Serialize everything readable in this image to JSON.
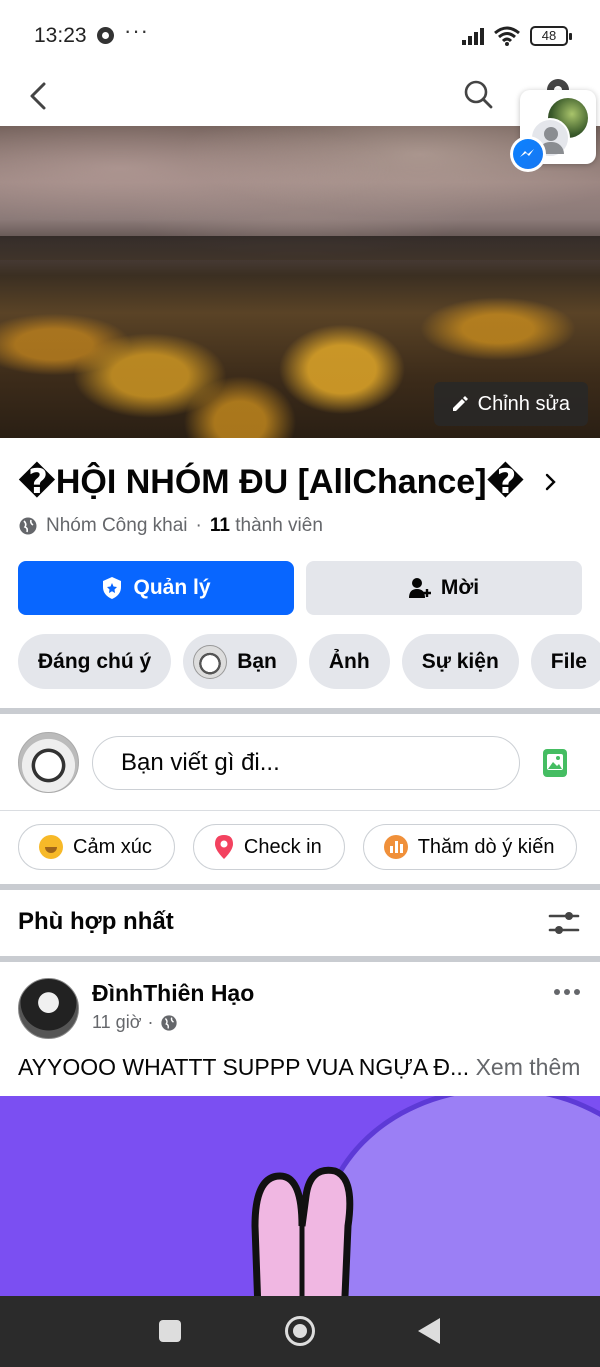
{
  "status_bar": {
    "time": "13:23",
    "more": "···",
    "battery": "48",
    "icons": [
      "chrome-icon",
      "signal-icon",
      "wifi-icon",
      "battery-icon"
    ]
  },
  "nav": {
    "icons": [
      "back-icon",
      "search-icon",
      "gear-icon"
    ]
  },
  "cover": {
    "edit_label": "Chỉnh sửa"
  },
  "group": {
    "title": "�HỘI NHÓM ĐU [AllChance]�",
    "privacy": "Nhóm Công khai",
    "separator": "·",
    "member_count": "11",
    "member_label": "thành viên"
  },
  "buttons": {
    "manage": "Quản lý",
    "invite": "Mời"
  },
  "chips": [
    "Đáng chú ý",
    "Bạn",
    "Ảnh",
    "Sự kiện",
    "File"
  ],
  "composer": {
    "placeholder": "Bạn viết gì đi..."
  },
  "actions": [
    "Cảm xúc",
    "Check in",
    "Thăm dò ý kiến"
  ],
  "sort": {
    "title": "Phù hợp nhất"
  },
  "post": {
    "author": "ĐìnhThiên Hạo",
    "time": "11 giờ",
    "separator": "·",
    "text": "AYYOOO WHATTT SUPPP VUA NGỰA Đ...",
    "see_more": "Xem thêm"
  },
  "colors": {
    "primary": "#0866ff",
    "secondary_bg": "#e4e6eb",
    "muted_text": "#65676b",
    "photo_green": "#45bd62",
    "pin_red": "#f3425f",
    "post_image_bg": "#7b4ff2"
  }
}
